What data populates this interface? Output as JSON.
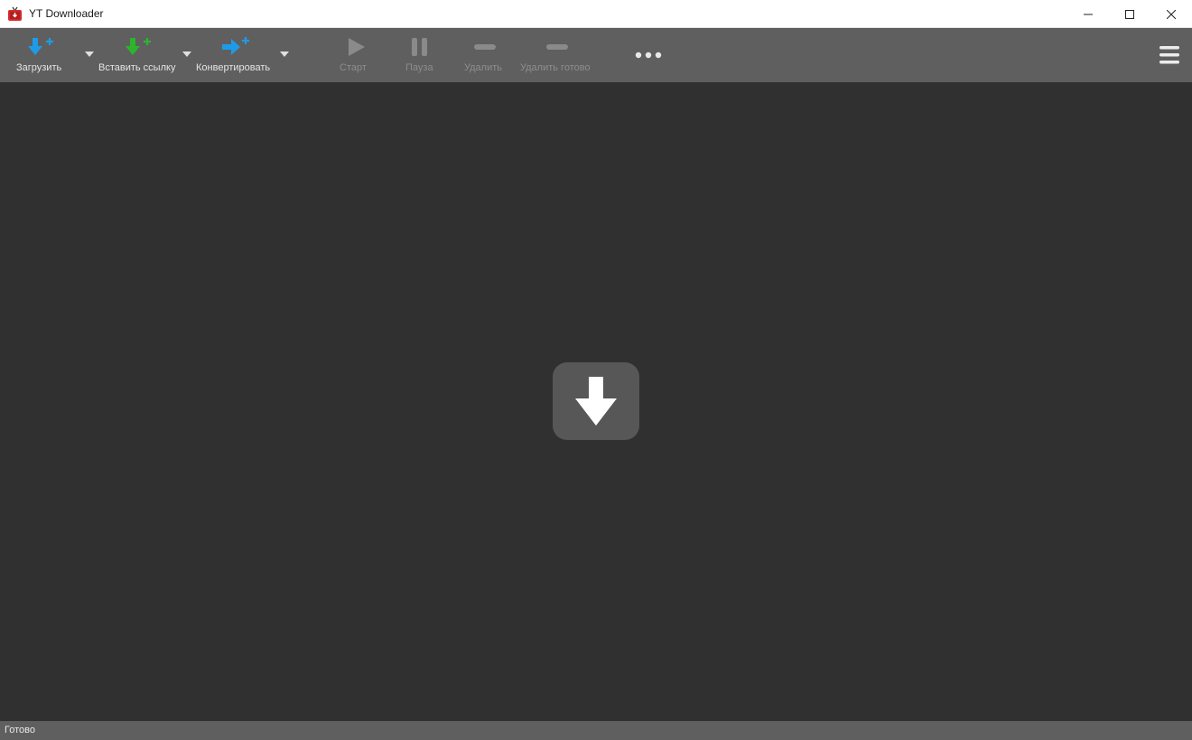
{
  "window": {
    "title": "YT Downloader"
  },
  "toolbar": {
    "download_label": "Загрузить",
    "paste_link_label": "Вставить ссылку",
    "convert_label": "Конвертировать",
    "start_label": "Старт",
    "pause_label": "Пауза",
    "delete_label": "Удалить",
    "delete_done_label": "Удалить готово"
  },
  "status": {
    "text": "Готово"
  },
  "colors": {
    "accent_blue": "#1e9be8",
    "accent_green": "#2bb52b",
    "toolbar_bg": "#5f5f5f",
    "main_bg": "#303030"
  },
  "icons": {
    "download": "arrow-down-plus-icon",
    "paste_link": "arrow-down-plus-icon",
    "convert": "arrow-right-plus-icon",
    "start": "play-icon",
    "pause": "pause-icon",
    "delete": "minus-icon",
    "more": "more-dots-icon",
    "menu": "hamburger-menu-icon",
    "drop_zone": "download-arrow-icon"
  }
}
